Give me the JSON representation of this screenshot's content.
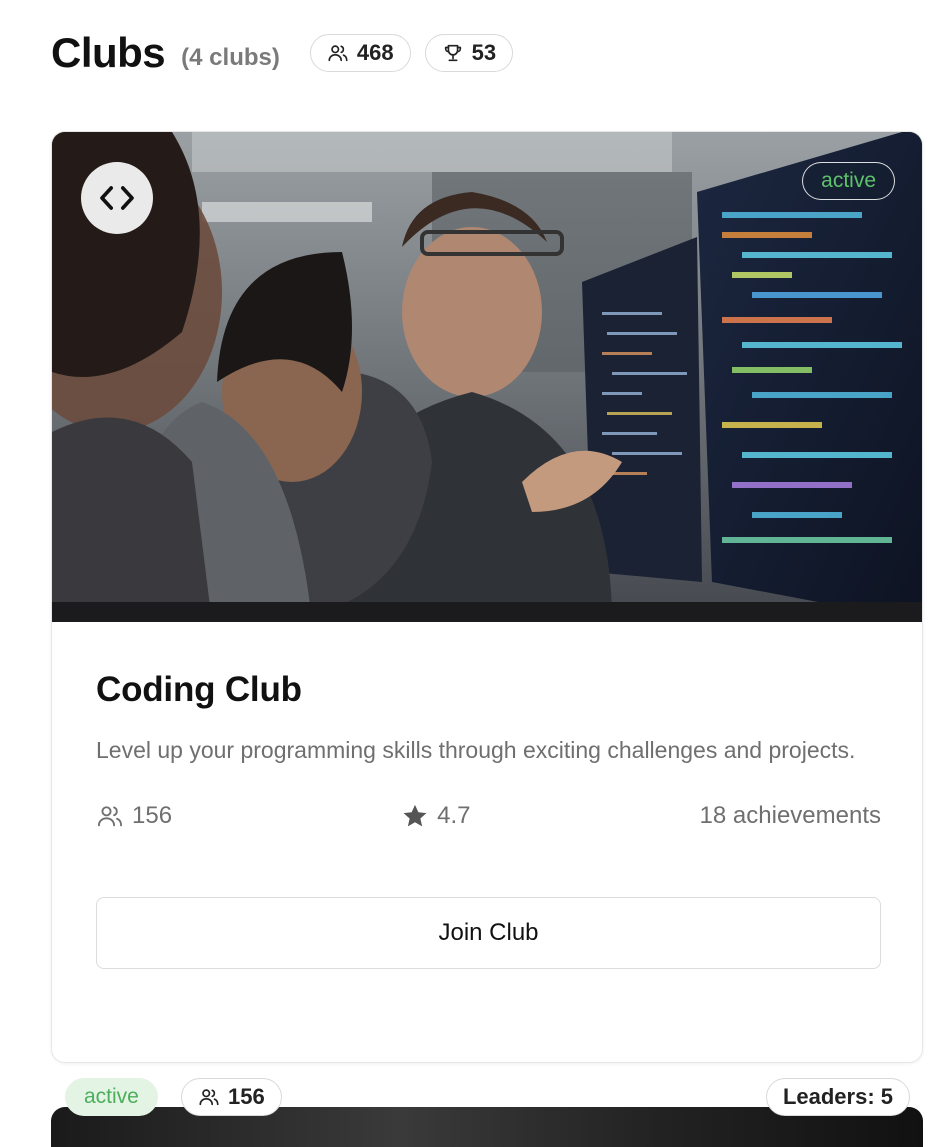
{
  "header": {
    "title": "Clubs",
    "count": "(4 clubs)",
    "members_total": "468",
    "achievements_total": "53"
  },
  "club": {
    "status": "active",
    "icon": "code-icon",
    "name": "Coding Club",
    "description": "Level up your programming skills through exciting challenges and projects.",
    "members": "156",
    "rating": "4.7",
    "achievements": "18 achievements",
    "join_label": "Join Club"
  },
  "next_club": {
    "status": "active",
    "members": "156",
    "leaders": "Leaders: 5"
  },
  "colors": {
    "active_text": "#5dc26b",
    "active_bg": "#e3f3e4",
    "muted_text": "#6f6f6f"
  }
}
